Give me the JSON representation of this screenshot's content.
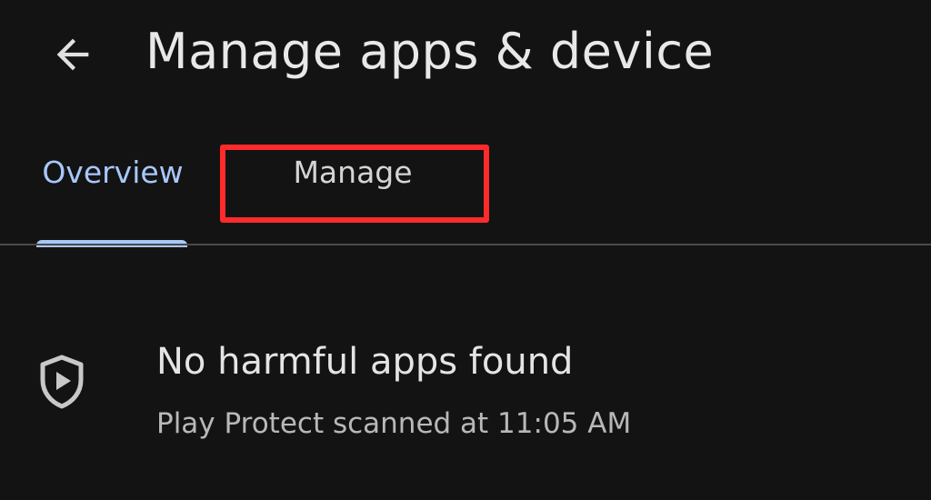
{
  "header": {
    "back_icon": "arrow-back-icon",
    "title": "Manage apps & device"
  },
  "tabs": [
    {
      "label": "Overview",
      "selected": true
    },
    {
      "label": "Manage",
      "selected": false,
      "highlighted": true
    }
  ],
  "colors": {
    "background": "#131313",
    "accent": "#a8c7fa",
    "highlight": "#ff2b2b"
  },
  "protect": {
    "icon": "play-protect-shield-icon",
    "title": "No harmful apps found",
    "subtitle": "Play Protect scanned at 11:05 AM"
  }
}
